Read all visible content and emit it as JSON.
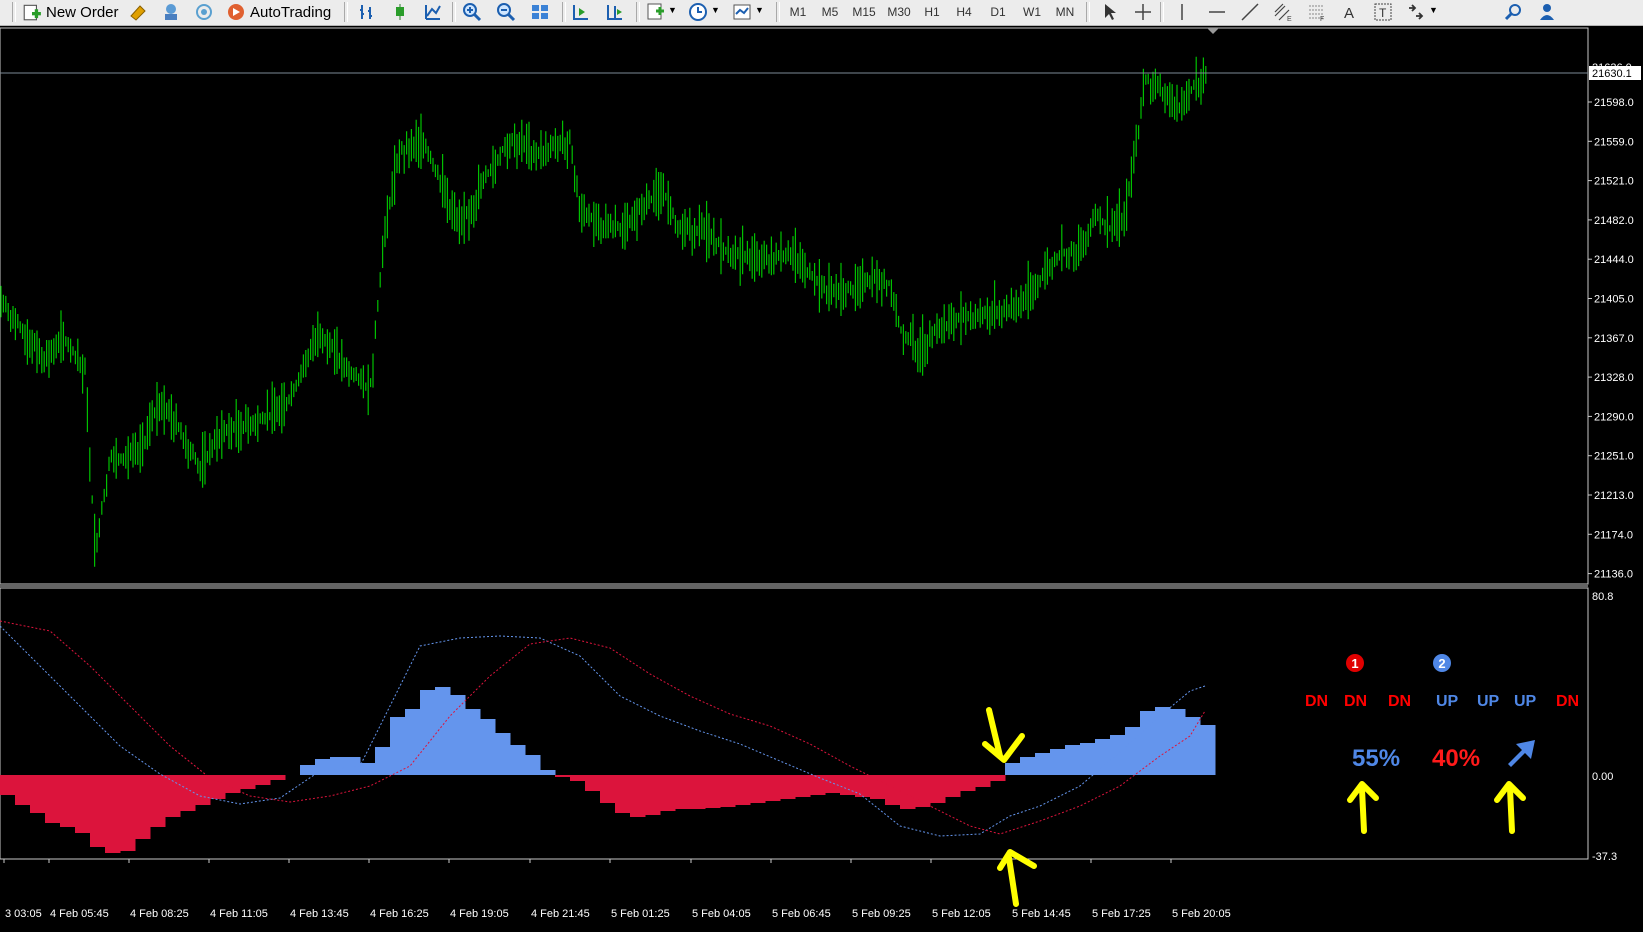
{
  "toolbar": {
    "new_order_label": "New Order",
    "autotrading_label": "AutoTrading",
    "timeframes": [
      "M1",
      "M5",
      "M15",
      "M30",
      "H1",
      "H4",
      "D1",
      "W1",
      "MN"
    ]
  },
  "price_axis": {
    "labels": [
      "21598.0",
      "21559.0",
      "21521.0",
      "21482.0",
      "21444.0",
      "21405.0",
      "21367.0",
      "21328.0",
      "21290.0",
      "21251.0",
      "21213.0",
      "21174.0",
      "21136.0"
    ],
    "current_price": "21630.1",
    "partial_top_label": "21636.0"
  },
  "indicator_axis": {
    "max_label": "80.8",
    "zero_label": "0.00",
    "min_label": "-37.3"
  },
  "time_axis": {
    "labels": [
      "3 03:05",
      "4 Feb 05:45",
      "4 Feb 08:25",
      "4 Feb 11:05",
      "4 Feb 13:45",
      "4 Feb 16:25",
      "4 Feb 19:05",
      "4 Feb 21:45",
      "5 Feb 01:25",
      "5 Feb 04:05",
      "5 Feb 06:45",
      "5 Feb 09:25",
      "5 Feb 12:05",
      "5 Feb 14:45",
      "5 Feb 17:25",
      "5 Feb 20:05"
    ]
  },
  "signal_panel": {
    "marker1": "1",
    "marker2": "2",
    "signals": [
      "DN",
      "DN",
      "DN",
      "UP",
      "UP",
      "UP",
      "DN"
    ],
    "percent_up": "55%",
    "percent_dn": "40%"
  },
  "colors": {
    "candles": "#00c000",
    "histogram_up": "#6495ed",
    "histogram_down": "#dc143c",
    "annotation": "#ffff00",
    "signal_dn": "#ff0000",
    "signal_up": "#4f87e6"
  }
}
